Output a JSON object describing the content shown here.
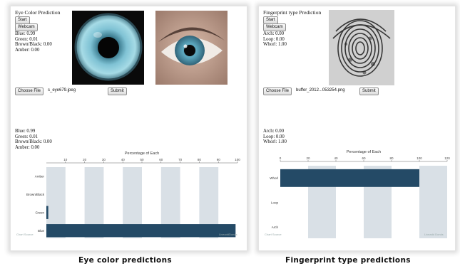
{
  "eye": {
    "title": "Eye Color Prediction",
    "start_label": "Start",
    "webcam_label": "Webcam",
    "predictions": [
      "Blue: 0.99",
      "Green: 0.01",
      "Brown/Black: 0.00",
      "Amber: 0.00"
    ],
    "choose_file_label": "Choose File",
    "file_name": "s_eye679.jpeg",
    "submit_label": "Submit",
    "summary": [
      "Blue: 0.99",
      "Green: 0.01",
      "Brown/Black: 0.00",
      "Amber: 0.00"
    ],
    "caption": "Eye color predictions",
    "footer_left": "Chart Source",
    "footer_right": "LiveaddDonds"
  },
  "fingerprint": {
    "title": "Fingerprint type Prediction",
    "start_label": "Start",
    "webcam_label": "Webcam",
    "predictions": [
      "Arch: 0.00",
      "Loop: 0.00",
      "Whorl: 1.00"
    ],
    "choose_file_label": "Choose File",
    "file_name": "buffer_2012...053254.png",
    "submit_label": "Submit",
    "summary": [
      "Arch: 0.00",
      "Loop: 0.00",
      "Whorl: 1.00"
    ],
    "caption": "Fingerprint type predictions",
    "footer_left": "Chart Source",
    "footer_right": "Liveadd Donds"
  },
  "colors": {
    "bar": "#244a66",
    "band": "#d9e0e6"
  },
  "chart_data": [
    {
      "type": "bar",
      "orientation": "horizontal",
      "title": "Percentage of Each",
      "categories": [
        "Amber",
        "Brown/Black",
        "Green",
        "Blue"
      ],
      "values": [
        0,
        0,
        1,
        99
      ],
      "xticks": [
        10,
        20,
        30,
        40,
        50,
        60,
        70,
        80,
        90,
        100
      ],
      "xlim": [
        0,
        100
      ],
      "grid": "alternating bands"
    },
    {
      "type": "bar",
      "orientation": "horizontal",
      "title": "Percentage of Each",
      "categories": [
        "Whorl",
        "Loop",
        "Arch"
      ],
      "values": [
        100,
        0,
        0
      ],
      "xticks": [
        0,
        20,
        40,
        60,
        80,
        100,
        120
      ],
      "xlim": [
        0,
        120
      ],
      "grid": "alternating bands"
    }
  ]
}
